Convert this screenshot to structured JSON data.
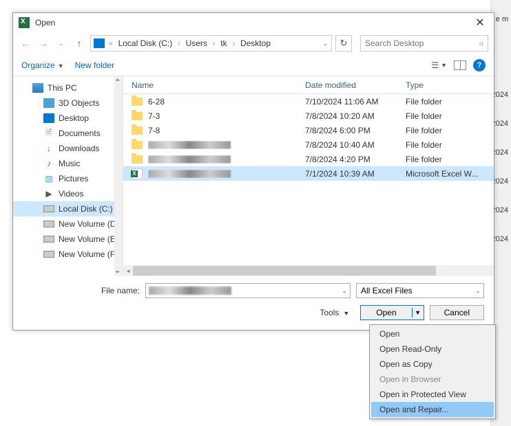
{
  "backdrop": {
    "year": "2024",
    "extra": "e m"
  },
  "title": "Open",
  "breadcrumb": {
    "root": "Local Disk (C:)",
    "p1": "Users",
    "p2": "tk",
    "p3": "Desktop"
  },
  "search": {
    "placeholder": "Search Desktop"
  },
  "toolbar": {
    "organize": "Organize",
    "newfolder": "New folder"
  },
  "tree": {
    "thispc": "This PC",
    "obj3d": "3D Objects",
    "desktop": "Desktop",
    "documents": "Documents",
    "downloads": "Downloads",
    "music": "Music",
    "pictures": "Pictures",
    "videos": "Videos",
    "diskc": "Local Disk (C:)",
    "diskd": "New Volume (D:)",
    "diske": "New Volume (E:)",
    "diskf": "New Volume (F:)"
  },
  "columns": {
    "name": "Name",
    "date": "Date modified",
    "type": "Type"
  },
  "files": [
    {
      "name": "6-28",
      "date": "7/10/2024 11:06 AM",
      "type": "File folder",
      "kind": "folder"
    },
    {
      "name": "7-3",
      "date": "7/8/2024 10:20 AM",
      "type": "File folder",
      "kind": "folder"
    },
    {
      "name": "7-8",
      "date": "7/8/2024 6:00 PM",
      "type": "File folder",
      "kind": "folder"
    },
    {
      "name": "",
      "date": "7/8/2024 10:40 AM",
      "type": "File folder",
      "kind": "folder",
      "redacted": true
    },
    {
      "name": "",
      "date": "7/8/2024 4:20 PM",
      "type": "File folder",
      "kind": "folder",
      "redacted": true
    },
    {
      "name": "",
      "date": "7/1/2024 10:39 AM",
      "type": "Microsoft Excel W...",
      "kind": "excel",
      "redacted": true,
      "selected": true
    }
  ],
  "footer": {
    "filename_label": "File name:",
    "filter": "All Excel Files",
    "tools": "Tools",
    "open": "Open",
    "cancel": "Cancel"
  },
  "dropdown": {
    "open": "Open",
    "readonly": "Open Read-Only",
    "copy": "Open as Copy",
    "browser": "Open in Browser",
    "protected": "Open in Protected View",
    "repair": "Open and Repair..."
  }
}
